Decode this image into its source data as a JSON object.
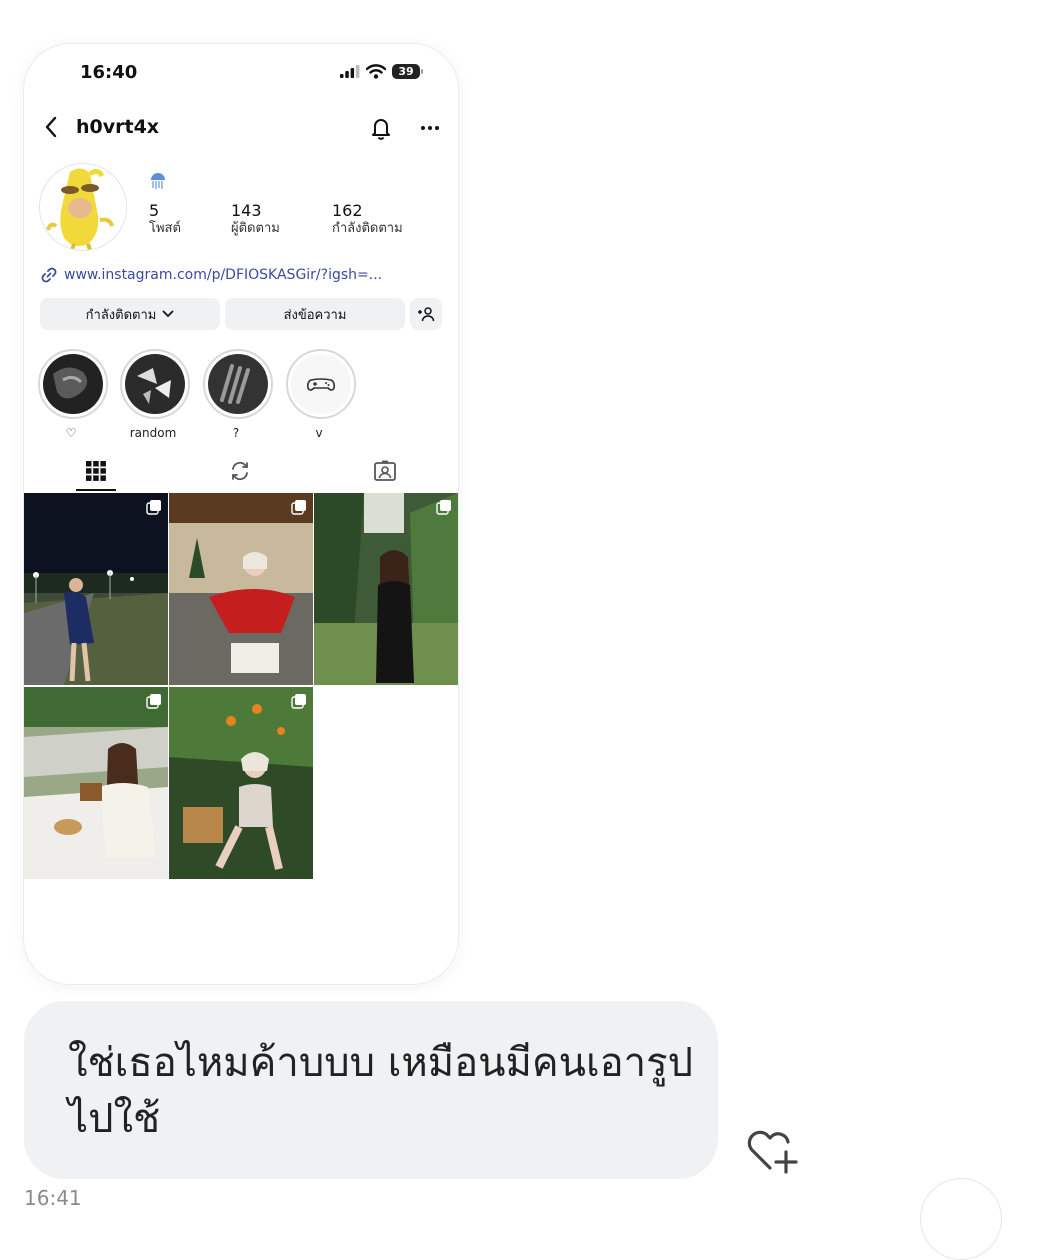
{
  "status_bar": {
    "time": "16:40",
    "battery": "39"
  },
  "profile": {
    "username": "h0vrt4x",
    "stats": [
      {
        "value": "5",
        "label": "โพสต์"
      },
      {
        "value": "143",
        "label": "ผู้ติดตาม"
      },
      {
        "value": "162",
        "label": "กำลังติดตาม"
      }
    ],
    "link": "www.instagram.com/p/DFIOSKASGir/?igsh=...",
    "buttons": {
      "following": "กำลังติดตาม",
      "message": "ส่งข้อความ"
    }
  },
  "highlights": [
    {
      "label": "♡"
    },
    {
      "label": "random"
    },
    {
      "label": "?"
    },
    {
      "label": "v"
    }
  ],
  "tabs": [
    "grid-icon",
    "reels-repost-icon",
    "tagged-icon"
  ],
  "posts_count_shown": 5,
  "message": {
    "text": "ใช่เธอไหมค้าบบบ เหมือนมีคนเอารูปไปใช้",
    "time": "16:41"
  },
  "colors": {
    "bubble": "#eff1f2",
    "link": "#3a4aa3",
    "button_bg": "#eff1f3"
  }
}
